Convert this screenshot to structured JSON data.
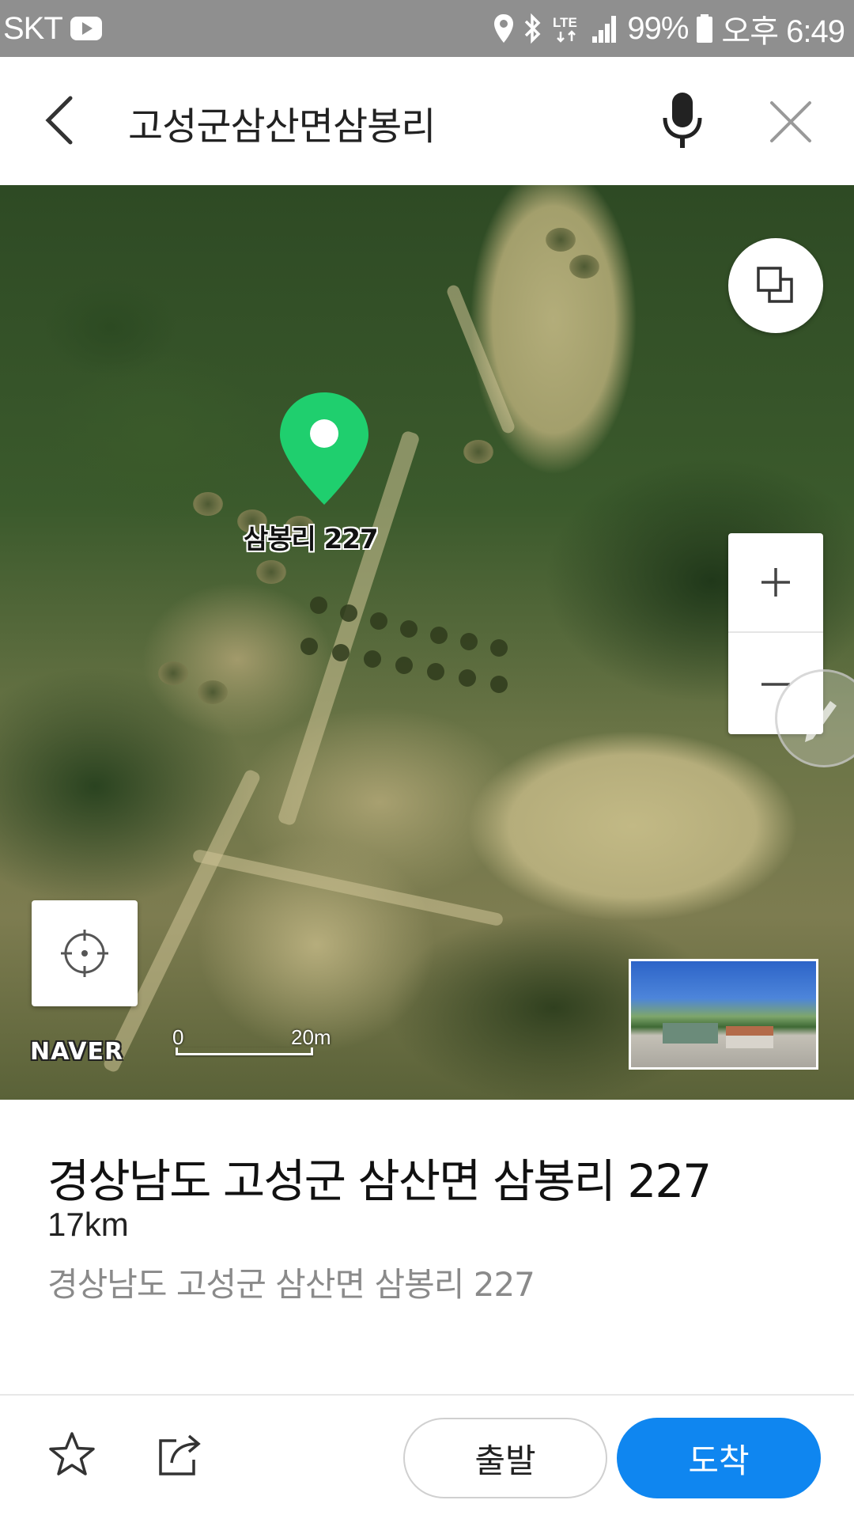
{
  "status_bar": {
    "carrier": "SKT",
    "network": "LTE",
    "battery": "99%",
    "time": "오후 6:49",
    "icons": [
      "youtube-icon",
      "location-icon",
      "bluetooth-icon",
      "lte-icon",
      "signal-icon",
      "battery-icon"
    ]
  },
  "header": {
    "title": "고성군삼산면삼봉리",
    "icons": [
      "back-arrow-icon",
      "microphone-icon",
      "close-icon"
    ]
  },
  "map": {
    "pin_label": "삼봉리 227",
    "pin_color": "#1fcf6e",
    "logo": "NAVER",
    "scale_start": "0",
    "scale_end": "20m",
    "icons": [
      "layers-icon",
      "zoom-in-icon",
      "zoom-out-icon",
      "pen-icon",
      "my-location-icon"
    ]
  },
  "place": {
    "title": "경상남도 고성군 삼산면 삼봉리 227",
    "distance": "17km",
    "address": "경상남도 고성군 삼산면 삼봉리 227"
  },
  "bottom_bar": {
    "start_label": "출발",
    "arrive_label": "도착",
    "arrive_color": "#0f86f0",
    "icons": [
      "star-icon",
      "share-icon"
    ]
  }
}
